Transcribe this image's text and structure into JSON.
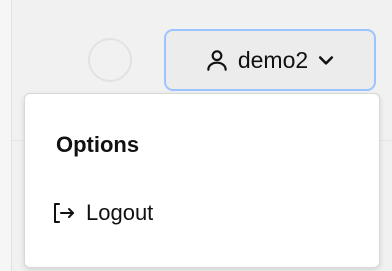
{
  "header": {
    "user_button": {
      "icon": "user-icon",
      "label": "demo2",
      "chevron": "chevron-down-icon",
      "focus_color": "#9cc4ff"
    },
    "spinner": {
      "icon": "loading-spinner"
    }
  },
  "dropdown": {
    "header": "Options",
    "items": [
      {
        "icon": "logout-icon",
        "label": "Logout"
      }
    ]
  }
}
